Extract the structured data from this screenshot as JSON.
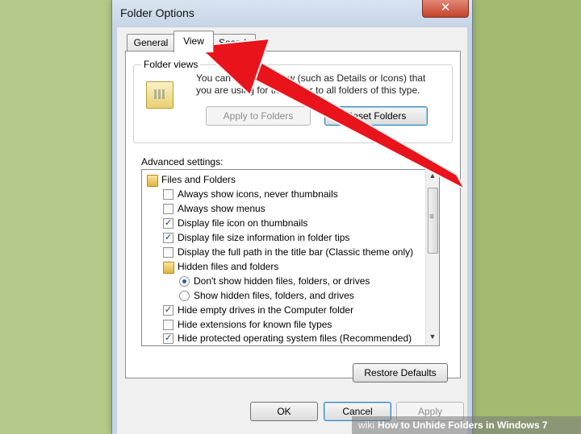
{
  "window": {
    "title": "Folder Options",
    "close_glyph": "✕"
  },
  "tabs": [
    {
      "label": "General",
      "active": false
    },
    {
      "label": "View",
      "active": true
    },
    {
      "label": "Search",
      "active": false
    }
  ],
  "folder_views": {
    "group_label": "Folder views",
    "description": "You can apply the view (such as Details or Icons) that you are using for this folder to all folders of this type.",
    "apply_button": "Apply to Folders",
    "reset_button": "Reset Folders"
  },
  "advanced": {
    "label": "Advanced settings:",
    "items": [
      {
        "type": "folder",
        "label": "Files and Folders"
      },
      {
        "type": "checkbox",
        "label": "Always show icons, never thumbnails",
        "checked": false
      },
      {
        "type": "checkbox",
        "label": "Always show menus",
        "checked": false
      },
      {
        "type": "checkbox",
        "label": "Display file icon on thumbnails",
        "checked": true
      },
      {
        "type": "checkbox",
        "label": "Display file size information in folder tips",
        "checked": true
      },
      {
        "type": "checkbox",
        "label": "Display the full path in the title bar (Classic theme only)",
        "checked": false
      },
      {
        "type": "folder",
        "label": "Hidden files and folders"
      },
      {
        "type": "radio",
        "label": "Don't show hidden files, folders, or drives",
        "selected": true
      },
      {
        "type": "radio",
        "label": "Show hidden files, folders, and drives",
        "selected": false
      },
      {
        "type": "checkbox",
        "label": "Hide empty drives in the Computer folder",
        "checked": true
      },
      {
        "type": "checkbox",
        "label": "Hide extensions for known file types",
        "checked": false
      },
      {
        "type": "checkbox",
        "label": "Hide protected operating system files (Recommended)",
        "checked": true
      }
    ],
    "check_glyph": "✓"
  },
  "buttons": {
    "restore_defaults": "Restore Defaults",
    "ok": "OK",
    "cancel": "Cancel",
    "apply": "Apply"
  },
  "watermark": {
    "brand": "wiki",
    "text": "How to Unhide Folders in Windows 7"
  },
  "colors": {
    "annotation_arrow": "#e8131b",
    "background": "#a9c07a"
  }
}
